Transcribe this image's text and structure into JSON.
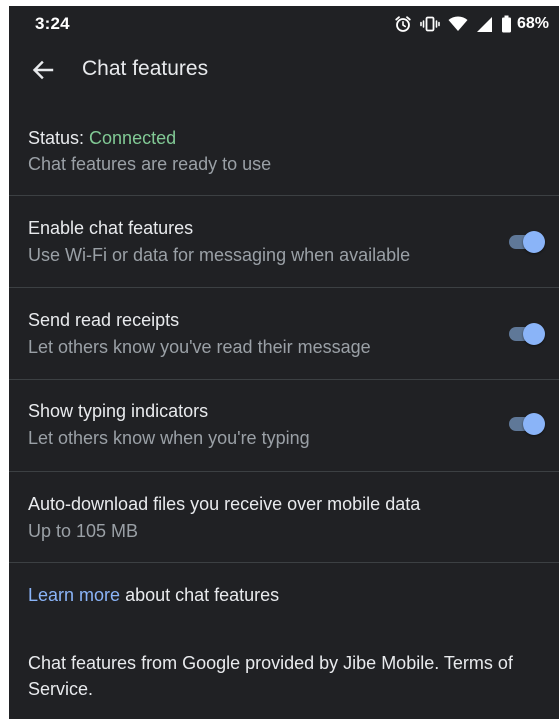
{
  "status_bar": {
    "time": "3:24",
    "battery": "68%",
    "icons": [
      "alarm-icon",
      "vibrate-icon",
      "wifi-icon",
      "cell-signal-icon",
      "battery-icon"
    ]
  },
  "app_bar": {
    "back_icon": "arrow-back-icon",
    "title": "Chat features"
  },
  "status": {
    "label": "Status: ",
    "value": "Connected",
    "value_color": "#81c995",
    "description": "Chat features are ready to use"
  },
  "settings": [
    {
      "title": "Enable chat features",
      "subtitle": "Use Wi-Fi or data for messaging when available",
      "enabled": true
    },
    {
      "title": "Send read receipts",
      "subtitle": "Let others know you've read their message",
      "enabled": true
    },
    {
      "title": "Show typing indicators",
      "subtitle": "Let others know when you're typing",
      "enabled": true
    }
  ],
  "auto_download": {
    "title": "Auto-download files you receive over mobile data",
    "value": "Up to 105 MB"
  },
  "learn_more": {
    "link": "Learn more",
    "rest": " about chat features",
    "link_color": "#8ab4f8"
  },
  "footer": {
    "text": "Chat features from Google provided by Jibe Mobile. Terms of Service."
  },
  "colors": {
    "background": "#202124",
    "toggle_thumb": "#8ab4f8",
    "toggle_track": "#5f7898"
  }
}
